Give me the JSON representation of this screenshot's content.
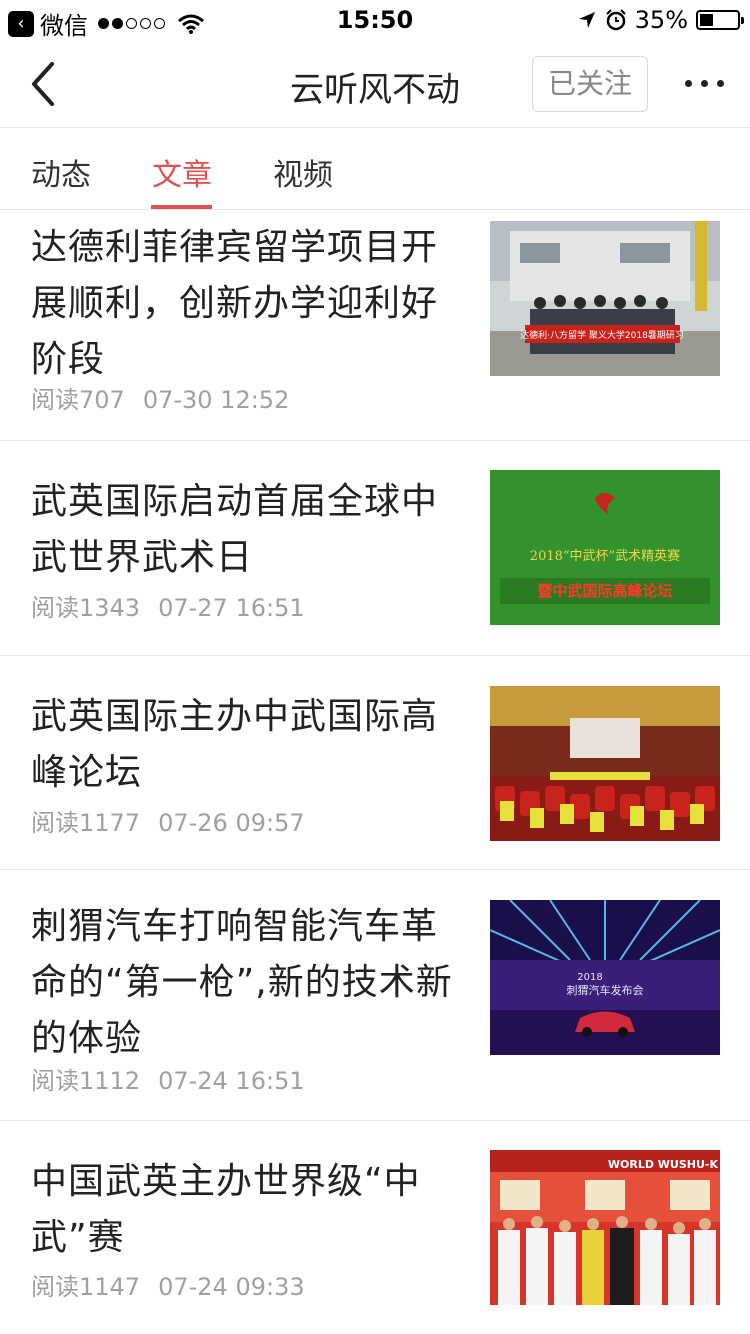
{
  "status_bar": {
    "carrier": "微信",
    "time": "15:50",
    "battery": "35%",
    "battery_level": 0.35
  },
  "nav": {
    "title": "云听风不动",
    "follow_label": "已关注"
  },
  "tabs": [
    {
      "label": "动态"
    },
    {
      "label": "文章"
    },
    {
      "label": "视频"
    }
  ],
  "active_tab": "文章",
  "articles": [
    {
      "title": "达德利菲律宾留学项目开展顺利，创新办学迎利好阶段",
      "reads": "阅读707",
      "date": "07-30 12:52",
      "banner_text": "达德利·八方留学 聚义大学2018暑期研习"
    },
    {
      "title": "武英国际启动首届全球中武世界武术日",
      "reads": "阅读1343",
      "date": "07-27 16:51",
      "poster_line1": "2018“中武杯”武术精英赛",
      "poster_line2": "暨中武国际高峰论坛"
    },
    {
      "title": "武英国际主办中武国际高峰论坛",
      "reads": "阅读1177",
      "date": "07-26 09:57"
    },
    {
      "title": "刺猬汽车打响智能汽车革命的“第一枪”,新的技术新的体验",
      "reads": "阅读1112",
      "date": "07-24 16:51",
      "stage_line1": "2018",
      "stage_line2": "刺猬汽车发布会"
    },
    {
      "title": "中国武英主办世界级“中武”赛",
      "reads": "阅读1147",
      "date": "07-24 09:33",
      "banner_text": "WORLD WUSHU-K"
    }
  ],
  "colors": {
    "accent": "#e05252",
    "meta_text": "#a0a0a0",
    "divider": "#e5e5e5"
  },
  "icons": [
    "wechat-back-icon",
    "wifi-icon",
    "location-icon",
    "alarm-icon",
    "battery-icon",
    "back-arrow-icon",
    "more-icon"
  ]
}
